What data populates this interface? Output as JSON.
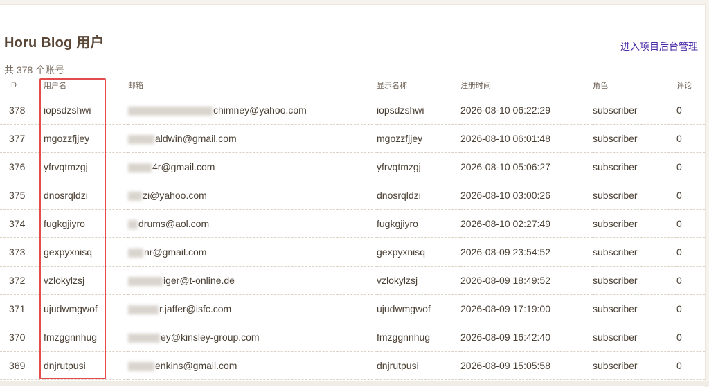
{
  "page": {
    "title": "Horu Blog 用户",
    "admin_link": "进入项目后台管理",
    "account_count": "共 378 个账号"
  },
  "table": {
    "headers": {
      "id": "ID",
      "username": "用户名",
      "email": "邮箱",
      "display_name": "显示名称",
      "registered": "注册时间",
      "role": "角色",
      "comments": "评论"
    },
    "rows": [
      {
        "id": "378",
        "username": "iopsdzshwi",
        "email_visible": "chimney@yahoo.com",
        "redacted": true,
        "display_name": "iopsdzshwi",
        "registered": "2026-08-10 06:22:29",
        "role": "subscriber",
        "comments": "0"
      },
      {
        "id": "377",
        "username": "mgozzfjjey",
        "email_visible": "aldwin@gmail.com",
        "redacted": true,
        "display_name": "mgozzfjjey",
        "registered": "2026-08-10 06:01:48",
        "role": "subscriber",
        "comments": "0"
      },
      {
        "id": "376",
        "username": "yfrvqtmzgj",
        "email_visible": "4r@gmail.com",
        "redacted": true,
        "display_name": "yfrvqtmzgj",
        "registered": "2026-08-10 05:06:27",
        "role": "subscriber",
        "comments": "0"
      },
      {
        "id": "375",
        "username": "dnosrqldzi",
        "email_visible": "zi@yahoo.com",
        "redacted": true,
        "display_name": "dnosrqldzi",
        "registered": "2026-08-10 03:00:26",
        "role": "subscriber",
        "comments": "0"
      },
      {
        "id": "374",
        "username": "fugkgjiyro",
        "email_visible": "drums@aol.com",
        "redacted": true,
        "display_name": "fugkgjiyro",
        "registered": "2026-08-10 02:27:49",
        "role": "subscriber",
        "comments": "0"
      },
      {
        "id": "373",
        "username": "gexpyxnisq",
        "email_visible": "nr@gmail.com",
        "redacted": true,
        "display_name": "gexpyxnisq",
        "registered": "2026-08-09 23:54:52",
        "role": "subscriber",
        "comments": "0"
      },
      {
        "id": "372",
        "username": "vzlokylzsj",
        "email_visible": "iger@t-online.de",
        "redacted": true,
        "display_name": "vzlokylzsj",
        "registered": "2026-08-09 18:49:52",
        "role": "subscriber",
        "comments": "0"
      },
      {
        "id": "371",
        "username": "ujudwmgwof",
        "email_visible": "r.jaffer@isfc.com",
        "redacted": true,
        "display_name": "ujudwmgwof",
        "registered": "2026-08-09 17:19:00",
        "role": "subscriber",
        "comments": "0"
      },
      {
        "id": "370",
        "username": "fmzggnnhug",
        "email_visible": "ey@kinsley-group.com",
        "redacted": true,
        "display_name": "fmzggnnhug",
        "registered": "2026-08-09 16:42:40",
        "role": "subscriber",
        "comments": "0"
      },
      {
        "id": "369",
        "username": "dnjrutpusi",
        "email_visible": "enkins@gmail.com",
        "redacted": true,
        "display_name": "dnjrutpusi",
        "registered": "2026-08-09 15:05:58",
        "role": "subscriber",
        "comments": "0"
      }
    ]
  },
  "colors": {
    "highlight": "#e24c4c",
    "link": "#4b2aa8",
    "title": "#5a4636"
  }
}
